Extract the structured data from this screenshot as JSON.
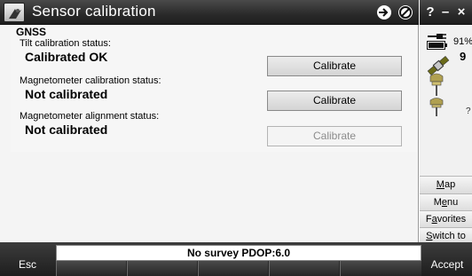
{
  "window": {
    "title": "Sensor calibration",
    "help_label": "?",
    "minimize_label": "–",
    "close_label": "×",
    "nav_icon": "navigation-icon",
    "noref_icon": "no-entry-icon"
  },
  "group": {
    "title": "GNSS"
  },
  "fields": [
    {
      "label": "Tilt calibration status:",
      "value": "Calibrated OK",
      "button": "Calibrate",
      "button_enabled": true
    },
    {
      "label": "Magnetometer calibration status:",
      "value": "Not calibrated",
      "button": "Calibrate",
      "button_enabled": true
    },
    {
      "label": "Magnetometer alignment status:",
      "value": "Not calibrated",
      "button": "Calibrate",
      "button_enabled": false
    }
  ],
  "status": {
    "battery_percent": "91%",
    "satellite_count": "9",
    "receiver_unknown": "?"
  },
  "side_menu": [
    {
      "label": "Map",
      "access_key": "M"
    },
    {
      "label": "Menu",
      "access_key": "e"
    },
    {
      "label": "Favorites",
      "access_key": "a"
    },
    {
      "label": "Switch to",
      "access_key": "S"
    }
  ],
  "bottom": {
    "status_line": "No survey  PDOP:6.0",
    "esc_label": "Esc",
    "accept_label": "Accept"
  },
  "colors": {
    "titlebar": "#2a2a2a",
    "content_bg": "#f4f4f4",
    "bottombar": "#1e1e1e"
  }
}
